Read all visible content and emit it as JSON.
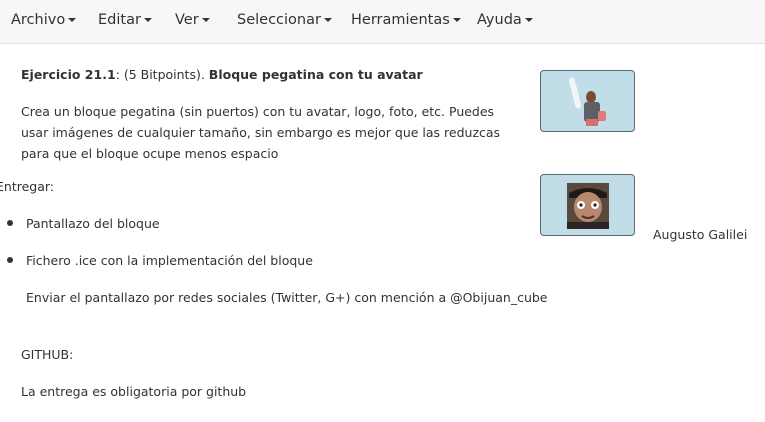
{
  "menubar": {
    "items": [
      {
        "label": "Archivo"
      },
      {
        "label": "Editar"
      },
      {
        "label": "Ver"
      },
      {
        "label": "Seleccionar"
      },
      {
        "label": "Herramientas"
      },
      {
        "label": "Ayuda"
      }
    ]
  },
  "exercise": {
    "number": "Ejercicio 21.1",
    "points": ": (5 Bitpoints). ",
    "title": "Bloque pegatina con tu avatar",
    "description_lines": [
      "Crea un bloque pegatina (sin puertos) con tu avatar, logo, foto, etc. Puedes",
      "usar imágenes de cualquier tamaño, sin embargo es mejor que las reduzcas",
      "para que el bloque ocupe menos espacio"
    ],
    "entregar_label": "Entregar:",
    "bullets": [
      "Pantallazo del bloque",
      "Fichero .ice con la implementación del bloque"
    ],
    "social_note": "Enviar el pantallazo por redes sociales (Twitter, G+) con mención a @Obijuan_cube",
    "github_label": "GITHUB:",
    "github_note": "La entrega es obligatoria por github"
  },
  "blocks": [
    {
      "name": "",
      "avatar": "lightsaber-figure-avatar"
    },
    {
      "name": "Augusto Galilei",
      "avatar": "face-photo-avatar"
    }
  ],
  "colors": {
    "block_fill": "#c1dde8",
    "block_border": "#5a6770",
    "menubar_bg": "#f7f7f7"
  }
}
